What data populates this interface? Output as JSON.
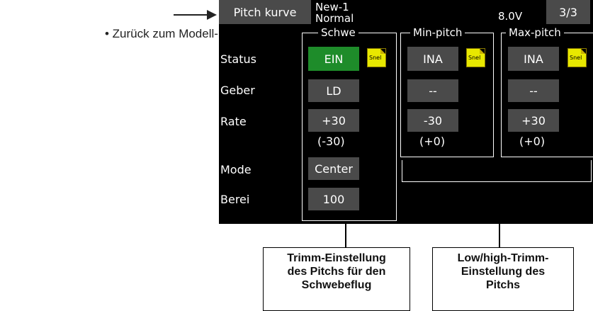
{
  "annotation": {
    "back_text": "• Zurück zum Modell-Menü"
  },
  "header": {
    "title_button": "Pitch kurve",
    "model_name": "New-1",
    "condition": "Normal",
    "voltage": "8.0V",
    "page": "3/3"
  },
  "groups": {
    "hover": "Schwe",
    "min": "Min-pitch",
    "max": "Max-pitch"
  },
  "rows": {
    "status": "Status",
    "geber": "Geber",
    "rate": "Rate",
    "mode": "Mode",
    "berei": "Berei"
  },
  "hover": {
    "status": "EIN",
    "geber": "LD",
    "rate": "+30",
    "rate_sub": "(-30)",
    "mode": "Center",
    "berei": "100"
  },
  "min": {
    "status": "INA",
    "geber": "--",
    "rate": "-30",
    "rate_sub": "(+0)"
  },
  "max": {
    "status": "INA",
    "geber": "--",
    "rate": "+30",
    "rate_sub": "(+0)"
  },
  "snel_label": "Snel",
  "callouts": {
    "hover": [
      "Trimm-Einstellung",
      "des Pitchs für den",
      "Schwebeflug"
    ],
    "lowhigh": [
      "Low/high-Trimm-",
      "Einstellung des",
      "Pitchs"
    ]
  },
  "colors": {
    "screen_bg": "#000000",
    "button": "#4a4a4a",
    "active": "#1e8c2a",
    "snel": "#e8e800"
  }
}
